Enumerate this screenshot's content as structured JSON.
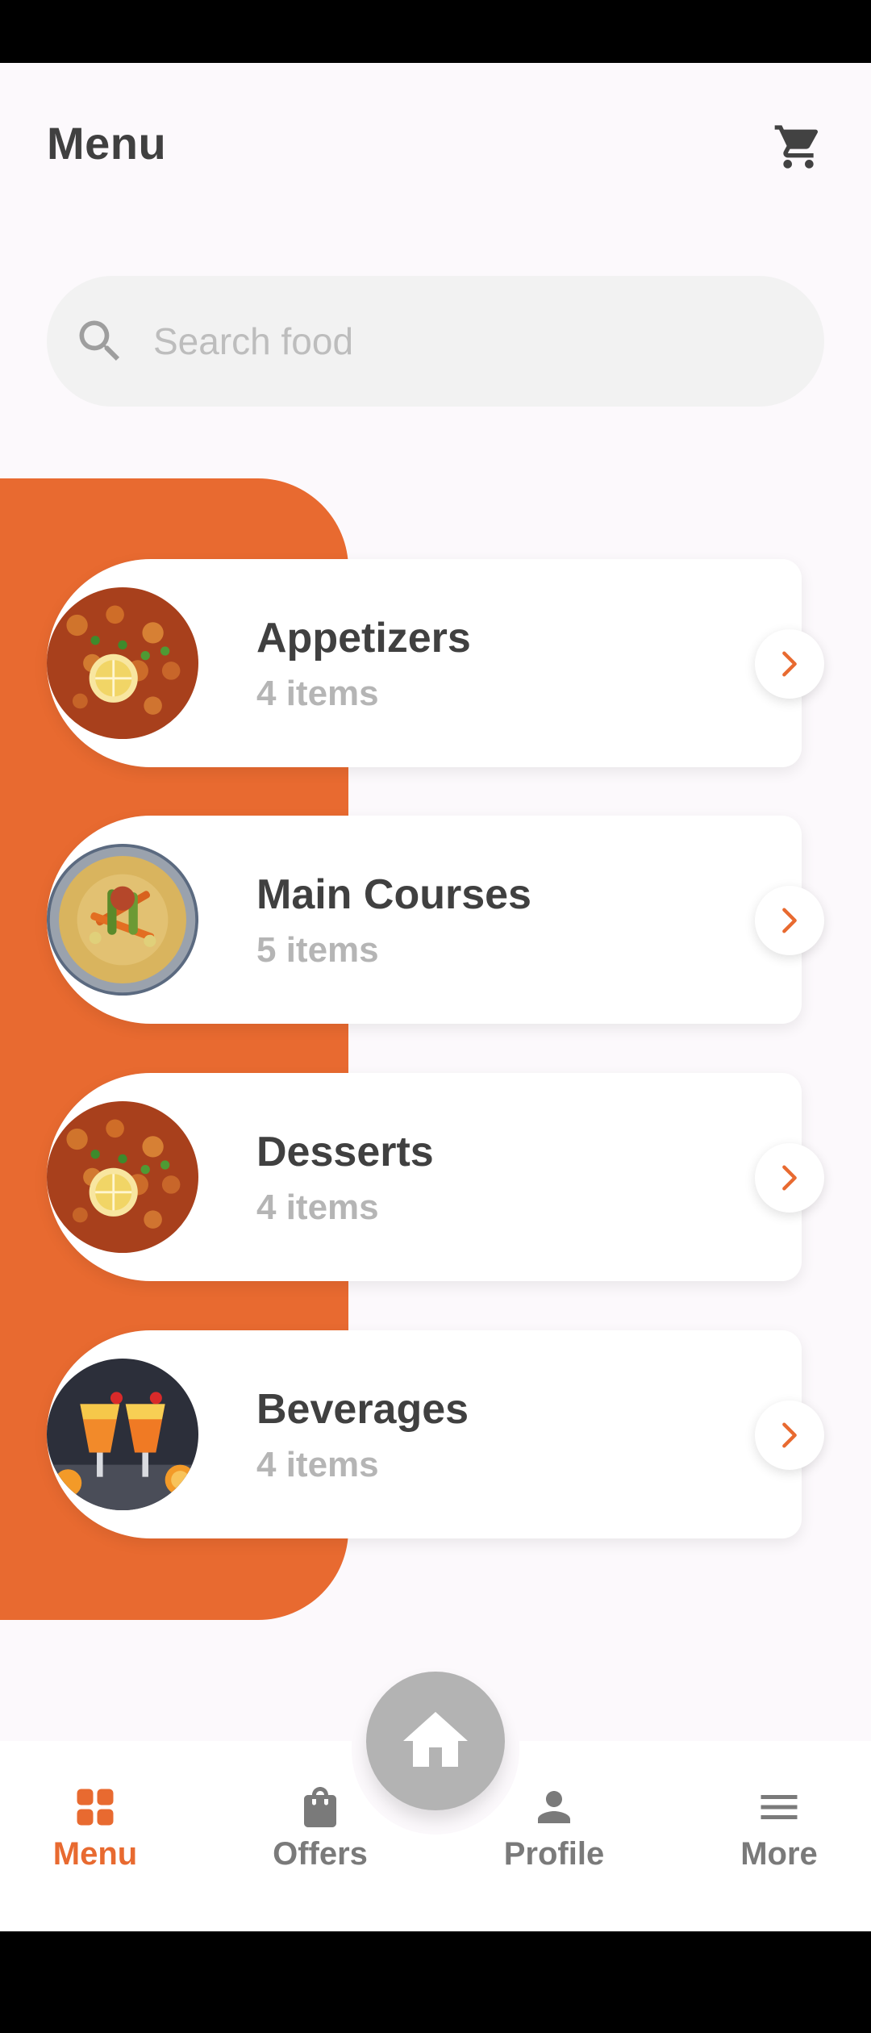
{
  "header": {
    "title": "Menu",
    "cart_icon": "cart-icon"
  },
  "search": {
    "placeholder": "Search food",
    "icon": "search-icon"
  },
  "categories": [
    {
      "title": "Appetizers",
      "count": "4 items",
      "image": "stew"
    },
    {
      "title": "Main Courses",
      "count": "5 items",
      "image": "couscous"
    },
    {
      "title": "Desserts",
      "count": "4 items",
      "image": "stew"
    },
    {
      "title": "Beverages",
      "count": "4 items",
      "image": "cocktails"
    }
  ],
  "bottom_nav": {
    "items": [
      {
        "label": "Menu",
        "icon": "grid-icon",
        "active": true
      },
      {
        "label": "Offers",
        "icon": "bag-icon",
        "active": false
      },
      {
        "label": "Profile",
        "icon": "person-icon",
        "active": false
      },
      {
        "label": "More",
        "icon": "menu-lines-icon",
        "active": false
      }
    ],
    "center_button_icon": "home-icon"
  },
  "colors": {
    "accent": "#e86a30",
    "text_dark": "#404040",
    "text_muted": "#b5b5b5",
    "fab": "#b3b3b3"
  }
}
